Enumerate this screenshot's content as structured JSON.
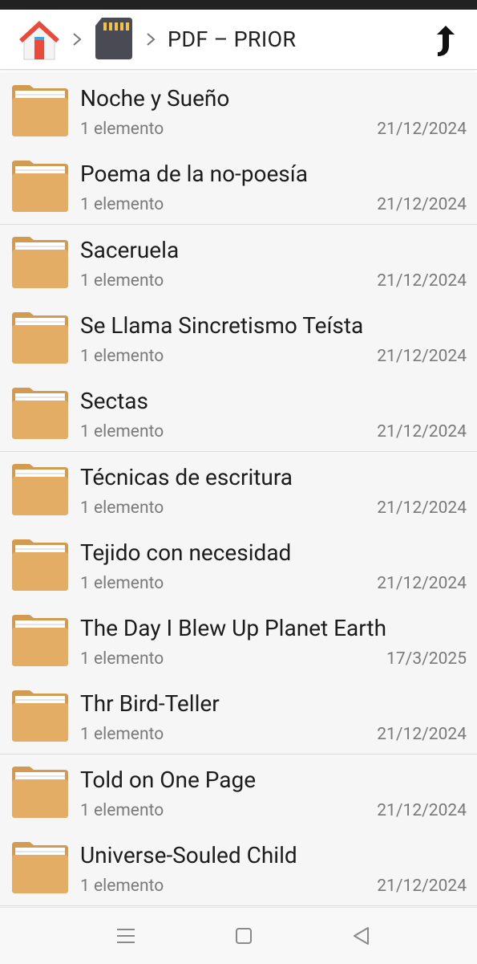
{
  "header": {
    "breadcrumb_home_icon": "home-icon",
    "breadcrumb_storage_icon": "sd-card-icon",
    "current_folder": "PDF – PRIOR",
    "up_icon": "up-arrow-icon"
  },
  "folders": [
    {
      "name": "Noche y Sueño",
      "count": "1 elemento",
      "date": "21/12/2024"
    },
    {
      "name": "Poema de la no-poesía",
      "count": "1 elemento",
      "date": "21/12/2024"
    },
    {
      "name": "Saceruela",
      "count": "1 elemento",
      "date": "21/12/2024"
    },
    {
      "name": "Se Llama Sincretismo Teísta",
      "count": "1 elemento",
      "date": "21/12/2024"
    },
    {
      "name": "Sectas",
      "count": "1 elemento",
      "date": "21/12/2024"
    },
    {
      "name": "Técnicas de escritura",
      "count": "1 elemento",
      "date": "21/12/2024"
    },
    {
      "name": "Tejido con necesidad",
      "count": "1 elemento",
      "date": "21/12/2024"
    },
    {
      "name": "The Day I Blew Up Planet Earth",
      "count": "1 elemento",
      "date": "17/3/2025"
    },
    {
      "name": "Thr Bird-Teller",
      "count": "1 elemento",
      "date": "21/12/2024"
    },
    {
      "name": "Told on One Page",
      "count": "1 elemento",
      "date": "21/12/2024"
    },
    {
      "name": "Universe-Souled Child",
      "count": "1 elemento",
      "date": "21/12/2024"
    }
  ],
  "colors": {
    "folder": "#e3ad66",
    "folder_back": "#d39a52",
    "text_primary": "#1c1c1c",
    "text_secondary": "#7a7a7a",
    "home_roof": "#e84a3c",
    "home_door": "#3aa7d8"
  },
  "navbar": {
    "menu_icon": "menu-icon",
    "home_icon": "square-home-icon",
    "back_icon": "triangle-back-icon"
  }
}
